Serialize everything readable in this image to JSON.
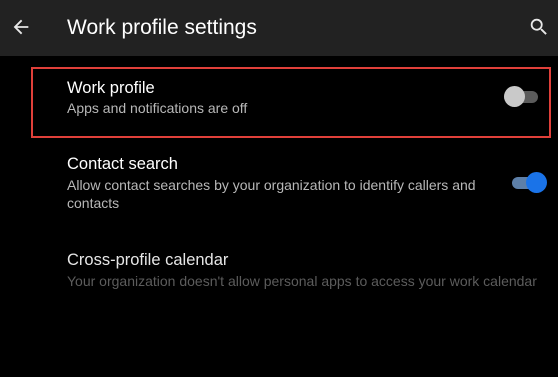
{
  "app_bar": {
    "title": "Work profile settings",
    "back_icon": "arrow-back-icon",
    "search_icon": "search-icon",
    "background": "#222222"
  },
  "settings": {
    "work_profile": {
      "title": "Work profile",
      "summary": "Apps and notifications are off",
      "toggle_on": false,
      "highlighted": true
    },
    "contact_search": {
      "title": "Contact search",
      "summary": "Allow contact searches by your organization to identify callers and contacts",
      "toggle_on": true
    },
    "cross_profile_calendar": {
      "title": "Cross-profile calendar",
      "summary": "Your organization doesn't allow personal apps to access your work calendar",
      "disabled": true
    }
  },
  "colors": {
    "accent": "#1a73e8",
    "highlight_border": "#e0403a",
    "background": "#000000"
  }
}
